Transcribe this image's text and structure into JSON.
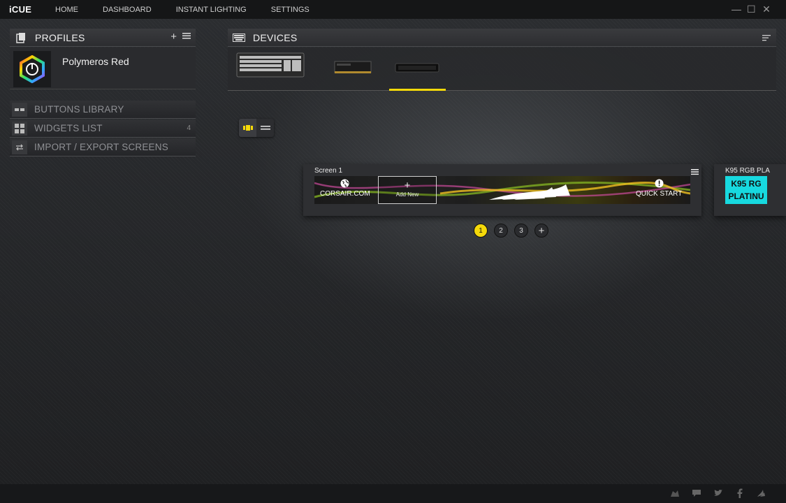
{
  "app": {
    "logo": "iCUE"
  },
  "nav": {
    "items": [
      "HOME",
      "DASHBOARD",
      "INSTANT LIGHTING",
      "SETTINGS"
    ]
  },
  "window_controls": [
    "minimize",
    "maximize",
    "close"
  ],
  "profiles": {
    "title": "PROFILES",
    "active_profile": "Polymeros Red"
  },
  "library": [
    {
      "label": "BUTTONS LIBRARY",
      "icon": "buttons-library-icon"
    },
    {
      "label": "WIDGETS LIST",
      "icon": "widgets-grid-icon",
      "count": "4"
    },
    {
      "label": "IMPORT / EXPORT SCREENS",
      "icon": "import-export-icon"
    }
  ],
  "devices": {
    "title": "DEVICES",
    "items": [
      {
        "icon": "keyboard-device-icon"
      },
      {
        "icon": "memory-device-icon"
      },
      {
        "icon": "ipad-device-icon",
        "active": true
      }
    ]
  },
  "screens": {
    "current": {
      "title": "Screen 1",
      "widgets": {
        "corsair_link": "CORSAIR.COM",
        "add_new": "Add New",
        "quick_start": "QUICK START"
      }
    },
    "next": {
      "title": "K95 RGB PLA",
      "tile_line1": "K95 RG",
      "tile_line2": "PLATINU"
    },
    "pages": [
      "1",
      "2",
      "3"
    ],
    "active_page": "1"
  },
  "colors": {
    "accent": "#f5d90a",
    "k95_tile": "#17d9df"
  },
  "footer_icons": [
    "ios-app-icon",
    "chat-icon",
    "twitter-icon",
    "facebook-icon",
    "corsair-sails-icon"
  ]
}
